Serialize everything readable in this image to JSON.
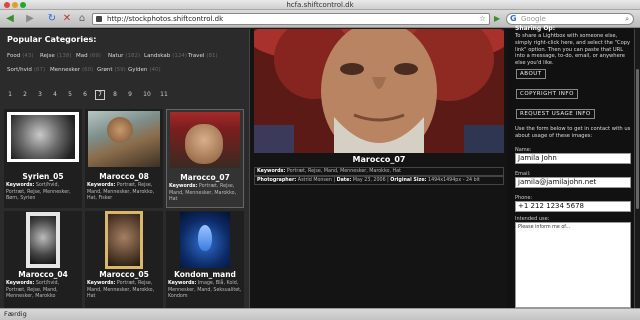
{
  "window": {
    "title": "hcfa.shiftcontrol.dk"
  },
  "toolbar": {
    "url": "http://stockphotos.shiftcontrol.dk",
    "search_placeholder": "Google"
  },
  "categories": {
    "heading": "Popular Categories:",
    "items": [
      {
        "label": "Food",
        "count": "(43)"
      },
      {
        "label": "Rejse",
        "count": "(138)"
      },
      {
        "label": "Mad",
        "count": "(69)"
      },
      {
        "label": "Natur",
        "count": "(182)"
      },
      {
        "label": "Landskab",
        "count": "(124)"
      },
      {
        "label": "Travel",
        "count": "(81)"
      },
      {
        "label": "Sort/hvid",
        "count": "(67)"
      },
      {
        "label": "Mennesker",
        "count": "(60)"
      },
      {
        "label": "Grønt",
        "count": "(59)"
      },
      {
        "label": "Gylden",
        "count": "(40)"
      }
    ]
  },
  "pager": {
    "pages": [
      "1",
      "2",
      "3",
      "4",
      "5",
      "6",
      "7",
      "8",
      "9",
      "10",
      "11"
    ],
    "current_index": 6
  },
  "thumbnails": [
    {
      "title": "Syrien_05",
      "keywords_label": "Keywords:",
      "keywords": "Sort/hvid, Portræt, Rejse, Mennesker, Børn, Syrien"
    },
    {
      "title": "Marocco_08",
      "keywords_label": "Keywords:",
      "keywords": "Portræt, Rejse, Mand, Mennesker, Marokko, Hat, Fisker"
    },
    {
      "title": "Marocco_07",
      "keywords_label": "Keywords:",
      "keywords": "Portræt, Rejse, Mand, Mennesker, Marokko, Hat"
    },
    {
      "title": "Marocco_04",
      "keywords_label": "Keywords:",
      "keywords": "Sort/hvid, Portræt, Rejse, Mand, Mennesker, Marokko"
    },
    {
      "title": "Marocco_05",
      "keywords_label": "Keywords:",
      "keywords": "Portræt, Rejse, Mand, Mennesker, Marokko, Hat"
    },
    {
      "title": "Kondom_mand",
      "keywords_label": "Keywords:",
      "keywords": "Image, Blå, Kold, Mennesker, Mand, Seksualitet, Kondom"
    }
  ],
  "detail": {
    "title": "Marocco_07",
    "keywords_label": "Keywords:",
    "keywords": "Portræt, Rejse, Mand, Mennesker, Marokko, Hat",
    "photographer_label": "Photographer:",
    "photographer": "Astrid Monsen",
    "date_label": "Date:",
    "date": "May 23, 2006",
    "size_label": "Original Size:",
    "size": "1494x1494px - 24 bit"
  },
  "sidebar": {
    "heading": "Sharing Op:",
    "intro": "To share a Lightbox with someone else, simply right-click here, and select the \"Copy link\" option. Then you can paste that URL into a message, to-do, email, or anywhere else you'd like.",
    "buttons": [
      "ABOUT",
      "COPYRIGHT INFO",
      "REQUEST USAGE INFO"
    ],
    "form_intro": "Use the form below to get in contact with us about usage of these images:",
    "name_label": "Name:",
    "name_value": "Jamila John",
    "email_label": "Email:",
    "email_value": "jamila@jamilajohn.net",
    "phone_label": "Phone:",
    "phone_value": "+1 212 1234 5678",
    "usage_label": "Intended use:",
    "usage_value": "Please inform me of..."
  },
  "status": {
    "text": "Færdig"
  }
}
